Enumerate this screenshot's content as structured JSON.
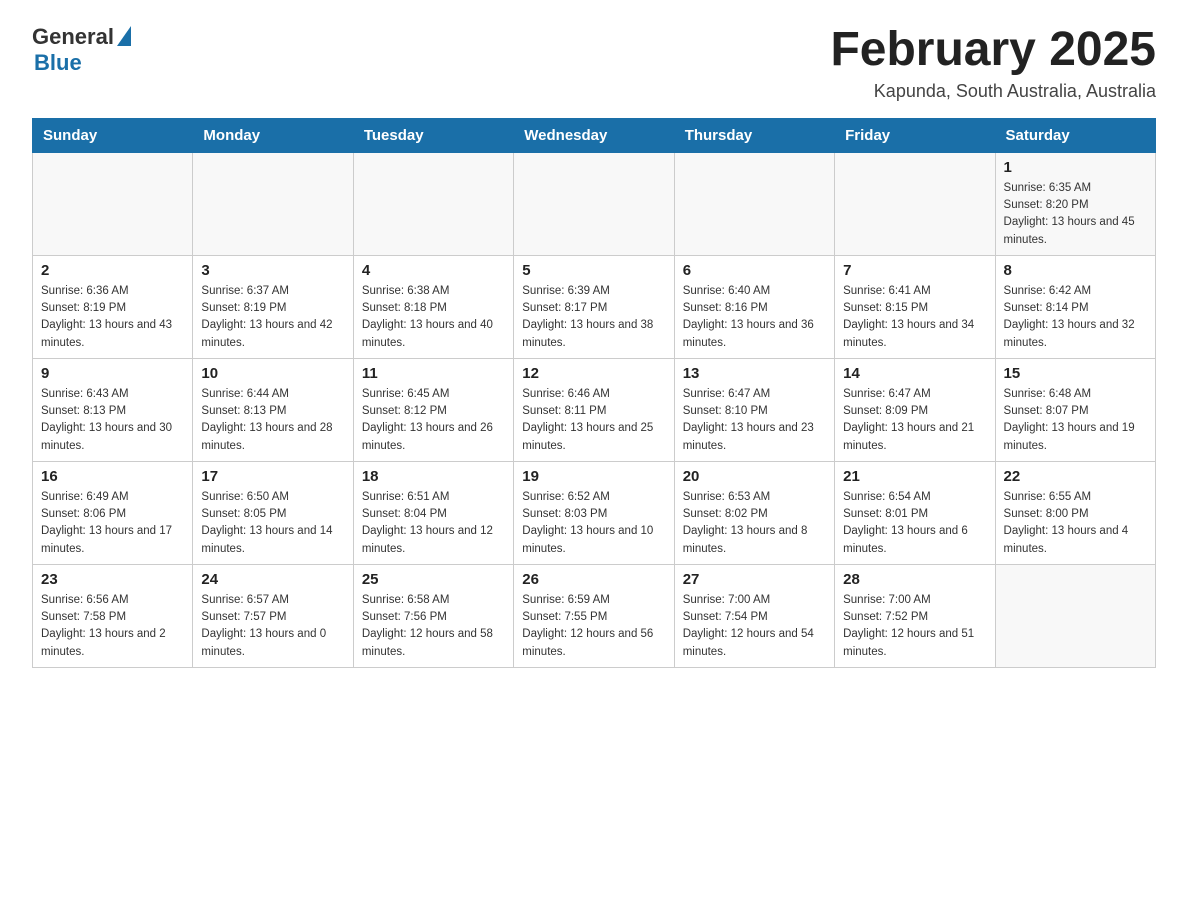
{
  "header": {
    "logo_general": "General",
    "logo_blue": "Blue",
    "month_title": "February 2025",
    "location": "Kapunda, South Australia, Australia"
  },
  "days_of_week": [
    "Sunday",
    "Monday",
    "Tuesday",
    "Wednesday",
    "Thursday",
    "Friday",
    "Saturday"
  ],
  "weeks": [
    [
      {
        "day": "",
        "info": ""
      },
      {
        "day": "",
        "info": ""
      },
      {
        "day": "",
        "info": ""
      },
      {
        "day": "",
        "info": ""
      },
      {
        "day": "",
        "info": ""
      },
      {
        "day": "",
        "info": ""
      },
      {
        "day": "1",
        "info": "Sunrise: 6:35 AM\nSunset: 8:20 PM\nDaylight: 13 hours and 45 minutes."
      }
    ],
    [
      {
        "day": "2",
        "info": "Sunrise: 6:36 AM\nSunset: 8:19 PM\nDaylight: 13 hours and 43 minutes."
      },
      {
        "day": "3",
        "info": "Sunrise: 6:37 AM\nSunset: 8:19 PM\nDaylight: 13 hours and 42 minutes."
      },
      {
        "day": "4",
        "info": "Sunrise: 6:38 AM\nSunset: 8:18 PM\nDaylight: 13 hours and 40 minutes."
      },
      {
        "day": "5",
        "info": "Sunrise: 6:39 AM\nSunset: 8:17 PM\nDaylight: 13 hours and 38 minutes."
      },
      {
        "day": "6",
        "info": "Sunrise: 6:40 AM\nSunset: 8:16 PM\nDaylight: 13 hours and 36 minutes."
      },
      {
        "day": "7",
        "info": "Sunrise: 6:41 AM\nSunset: 8:15 PM\nDaylight: 13 hours and 34 minutes."
      },
      {
        "day": "8",
        "info": "Sunrise: 6:42 AM\nSunset: 8:14 PM\nDaylight: 13 hours and 32 minutes."
      }
    ],
    [
      {
        "day": "9",
        "info": "Sunrise: 6:43 AM\nSunset: 8:13 PM\nDaylight: 13 hours and 30 minutes."
      },
      {
        "day": "10",
        "info": "Sunrise: 6:44 AM\nSunset: 8:13 PM\nDaylight: 13 hours and 28 minutes."
      },
      {
        "day": "11",
        "info": "Sunrise: 6:45 AM\nSunset: 8:12 PM\nDaylight: 13 hours and 26 minutes."
      },
      {
        "day": "12",
        "info": "Sunrise: 6:46 AM\nSunset: 8:11 PM\nDaylight: 13 hours and 25 minutes."
      },
      {
        "day": "13",
        "info": "Sunrise: 6:47 AM\nSunset: 8:10 PM\nDaylight: 13 hours and 23 minutes."
      },
      {
        "day": "14",
        "info": "Sunrise: 6:47 AM\nSunset: 8:09 PM\nDaylight: 13 hours and 21 minutes."
      },
      {
        "day": "15",
        "info": "Sunrise: 6:48 AM\nSunset: 8:07 PM\nDaylight: 13 hours and 19 minutes."
      }
    ],
    [
      {
        "day": "16",
        "info": "Sunrise: 6:49 AM\nSunset: 8:06 PM\nDaylight: 13 hours and 17 minutes."
      },
      {
        "day": "17",
        "info": "Sunrise: 6:50 AM\nSunset: 8:05 PM\nDaylight: 13 hours and 14 minutes."
      },
      {
        "day": "18",
        "info": "Sunrise: 6:51 AM\nSunset: 8:04 PM\nDaylight: 13 hours and 12 minutes."
      },
      {
        "day": "19",
        "info": "Sunrise: 6:52 AM\nSunset: 8:03 PM\nDaylight: 13 hours and 10 minutes."
      },
      {
        "day": "20",
        "info": "Sunrise: 6:53 AM\nSunset: 8:02 PM\nDaylight: 13 hours and 8 minutes."
      },
      {
        "day": "21",
        "info": "Sunrise: 6:54 AM\nSunset: 8:01 PM\nDaylight: 13 hours and 6 minutes."
      },
      {
        "day": "22",
        "info": "Sunrise: 6:55 AM\nSunset: 8:00 PM\nDaylight: 13 hours and 4 minutes."
      }
    ],
    [
      {
        "day": "23",
        "info": "Sunrise: 6:56 AM\nSunset: 7:58 PM\nDaylight: 13 hours and 2 minutes."
      },
      {
        "day": "24",
        "info": "Sunrise: 6:57 AM\nSunset: 7:57 PM\nDaylight: 13 hours and 0 minutes."
      },
      {
        "day": "25",
        "info": "Sunrise: 6:58 AM\nSunset: 7:56 PM\nDaylight: 12 hours and 58 minutes."
      },
      {
        "day": "26",
        "info": "Sunrise: 6:59 AM\nSunset: 7:55 PM\nDaylight: 12 hours and 56 minutes."
      },
      {
        "day": "27",
        "info": "Sunrise: 7:00 AM\nSunset: 7:54 PM\nDaylight: 12 hours and 54 minutes."
      },
      {
        "day": "28",
        "info": "Sunrise: 7:00 AM\nSunset: 7:52 PM\nDaylight: 12 hours and 51 minutes."
      },
      {
        "day": "",
        "info": ""
      }
    ]
  ]
}
